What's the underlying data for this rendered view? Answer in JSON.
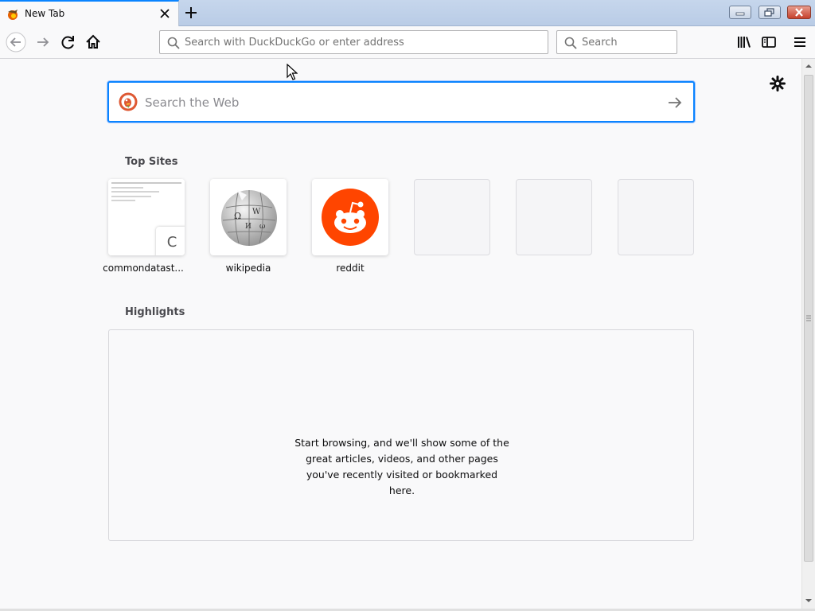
{
  "tab": {
    "title": "New Tab"
  },
  "toolbar": {
    "url_placeholder": "Search with DuckDuckGo or enter address",
    "search_placeholder": "Search"
  },
  "content": {
    "web_search_placeholder": "Search the Web",
    "top_sites_title": "Top Sites",
    "top_sites": [
      {
        "label": "commondatast...",
        "letter": "C"
      },
      {
        "label": "wikipedia"
      },
      {
        "label": "reddit"
      }
    ],
    "highlights_title": "Highlights",
    "highlights_message": "Start browsing, and we'll show some of the great articles, videos, and other pages you've recently visited or bookmarked here."
  },
  "colors": {
    "accent": "#0a84ff",
    "reddit": "#ff4500",
    "duckduckgo": "#de5833"
  },
  "icons": [
    "firefox-icon",
    "close-icon",
    "plus-icon",
    "back-icon",
    "forward-icon",
    "reload-icon",
    "home-icon",
    "search-icon",
    "library-icon",
    "sidebar-icon",
    "hamburger-menu-icon",
    "gear-icon",
    "duckduckgo-icon",
    "arrow-right-icon"
  ]
}
